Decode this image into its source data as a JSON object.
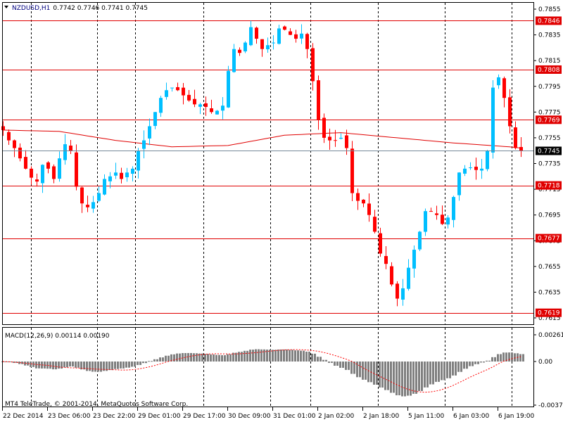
{
  "header": {
    "symbol_label": "NZDUSD,H1",
    "ohlc": "0.7742 0.7746 0.7741 0.7745"
  },
  "indicator": {
    "label": "MACD(12,26,9) 0.00114 0.00190"
  },
  "copyright": "MT4 TeleTrade, © 2001-2014, MetaQuotes Software Corp.",
  "colors": {
    "bull": "#00BFFF",
    "bear": "#FF0000",
    "level": "#E00000",
    "ma": "#E00000",
    "current": "#000000",
    "hist": "#808080",
    "signal": "#FF0000"
  },
  "chart_data": {
    "type": "candlestick",
    "price_ticks": [
      "0.7855",
      "0.7835",
      "0.7815",
      "0.7795",
      "0.7775",
      "0.7755",
      "0.7735",
      "0.7715",
      "0.7695",
      "0.7675",
      "0.7655",
      "0.7635",
      "0.7615"
    ],
    "price_range": [
      0.7615,
      0.7855
    ],
    "levels": [
      "0.7846",
      "0.7808",
      "0.7769",
      "0.7718",
      "0.7677",
      "0.7619"
    ],
    "current_price": "0.7745",
    "time_labels": [
      "22 Dec 2014",
      "23 Dec 06:00",
      "23 Dec 22:00",
      "29 Dec 01:00",
      "29 Dec 17:00",
      "30 Dec 09:00",
      "31 Dec 01:00",
      "2 Jan 02:00",
      "2 Jan 18:00",
      "5 Jan 11:00",
      "6 Jan 03:00",
      "6 Jan 19:00"
    ],
    "closes": [
      0.7761,
      0.7753,
      0.7747,
      0.7739,
      0.7731,
      0.7724,
      0.7721,
      0.7734,
      0.7731,
      0.7723,
      0.7739,
      0.775,
      0.7745,
      0.7717,
      0.7704,
      0.7701,
      0.7705,
      0.7712,
      0.7723,
      0.7725,
      0.7728,
      0.7723,
      0.7728,
      0.7731,
      0.7745,
      0.7753,
      0.7764,
      0.7775,
      0.7786,
      0.7792,
      0.7794,
      0.7792,
      0.7788,
      0.7784,
      0.7781,
      0.7781,
      0.7779,
      0.7775,
      0.7776,
      0.778,
      0.7807,
      0.7824,
      0.7821,
      0.7829,
      0.7841,
      0.7832,
      0.7824,
      0.7827,
      0.7829,
      0.784,
      0.7839,
      0.7835,
      0.7832,
      0.7836,
      0.7824,
      0.7799,
      0.7769,
      0.7755,
      0.7753,
      0.7753,
      0.7755,
      0.7747,
      0.7712,
      0.7706,
      0.7704,
      0.7695,
      0.7682,
      0.7665,
      0.7657,
      0.7641,
      0.763,
      0.7638,
      0.7654,
      0.7668,
      0.7682,
      0.7698,
      0.7698,
      0.7695,
      0.7688,
      0.7693,
      0.7709,
      0.7728,
      0.7731,
      0.7732,
      0.773,
      0.7731,
      0.7745,
      0.7794,
      0.7802,
      0.7786,
      0.7764,
      0.7747,
      0.7745
    ],
    "ma_anchors": [
      [
        0,
        0.7761
      ],
      [
        10,
        0.776
      ],
      [
        20,
        0.7753
      ],
      [
        30,
        0.7748
      ],
      [
        40,
        0.7749
      ],
      [
        50,
        0.7757
      ],
      [
        60,
        0.7759
      ],
      [
        70,
        0.7755
      ],
      [
        80,
        0.7751
      ],
      [
        90,
        0.7748
      ],
      [
        92,
        0.7747
      ]
    ],
    "macd": {
      "params": "12,26,9",
      "ticks": [
        "0.00261",
        "0.00",
        "-0.00375"
      ],
      "range": [
        -0.00375,
        0.00261
      ]
    }
  }
}
